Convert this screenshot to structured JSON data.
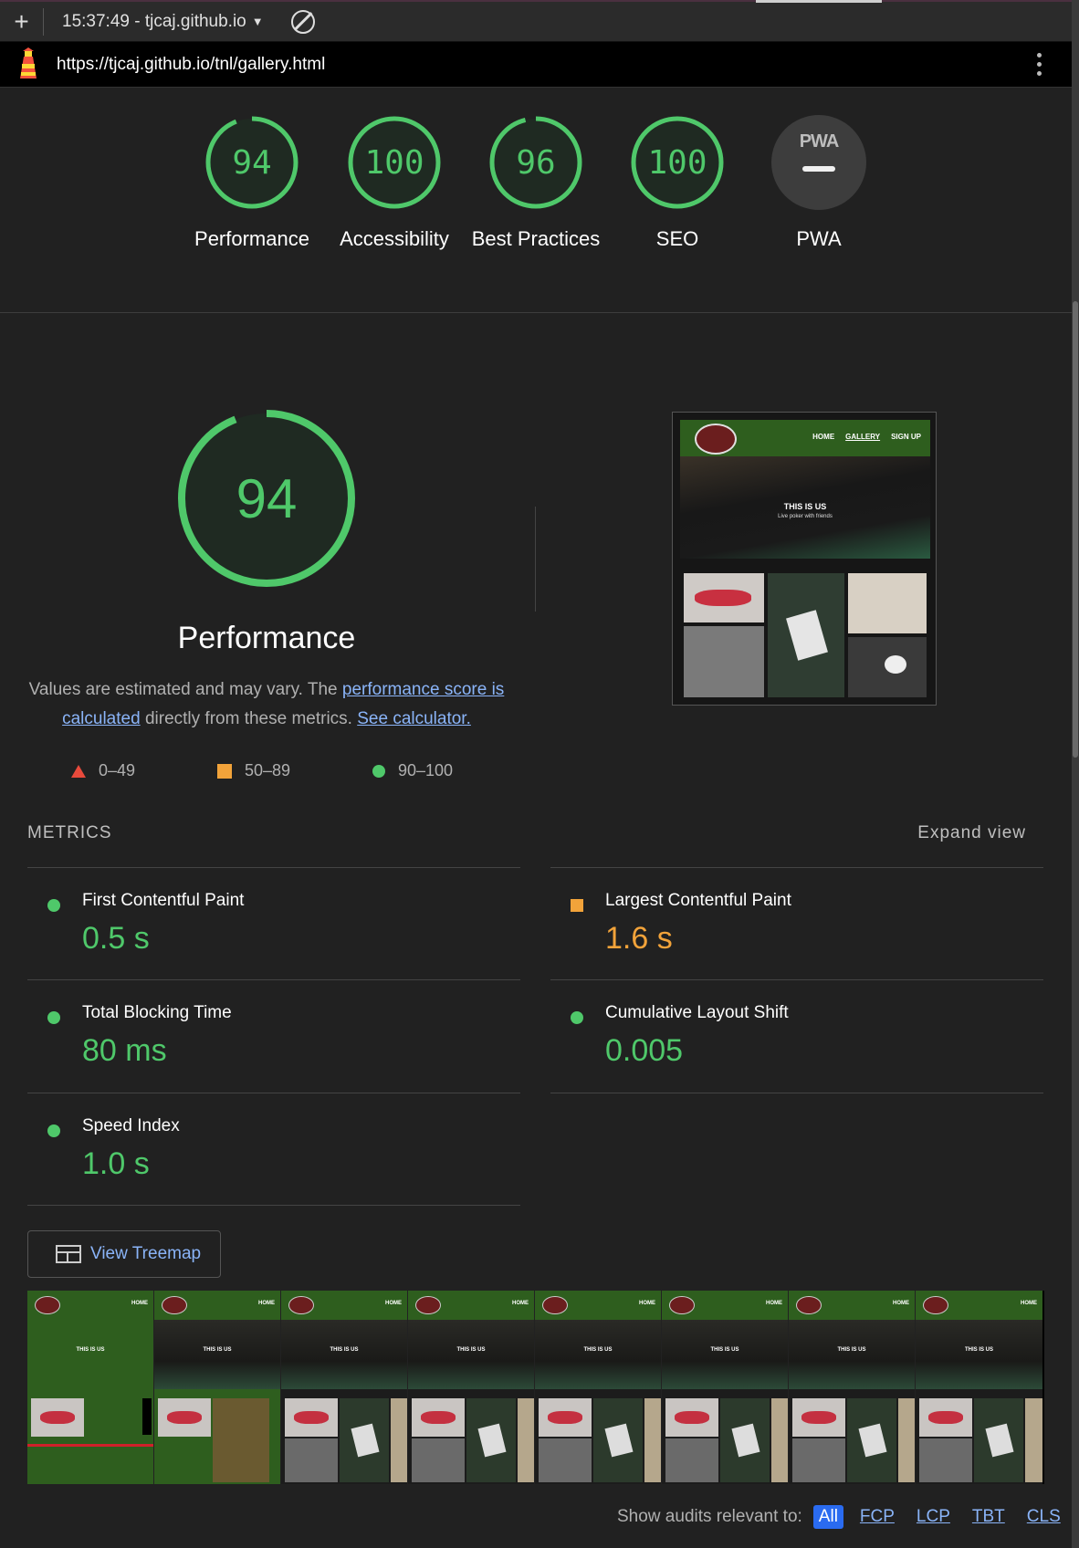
{
  "toolbar": {
    "new_label": "+",
    "report_select": "15:37:49 - tjcaj.github.io"
  },
  "urlbar": {
    "url": "https://tjcaj.github.io/tnl/gallery.html"
  },
  "categories": [
    {
      "label": "Performance",
      "score": 94
    },
    {
      "label": "Accessibility",
      "score": 100
    },
    {
      "label": "Best Practices",
      "score": 96
    },
    {
      "label": "SEO",
      "score": 100
    },
    {
      "label": "PWA",
      "score": null,
      "badge": "PWA"
    }
  ],
  "performance": {
    "score": 94,
    "title": "Performance",
    "desc_prefix": "Values are estimated and may vary. The ",
    "desc_link": "performance score is calculated",
    "desc_middle": " directly from these metrics. ",
    "desc_calc": "See calculator.",
    "final_screenshot": {
      "nav": [
        "HOME",
        "GALLERY",
        "SIGN UP"
      ],
      "hero_title": "THIS IS US",
      "hero_sub": "Live poker with friends"
    }
  },
  "legend": {
    "fail": "0–49",
    "average": "50–89",
    "pass": "90–100"
  },
  "metrics": {
    "title": "METRICS",
    "expand": "Expand view",
    "items": [
      {
        "label": "First Contentful Paint",
        "value": "0.5 s",
        "status": "pass"
      },
      {
        "label": "Largest Contentful Paint",
        "value": "1.6 s",
        "status": "average"
      },
      {
        "label": "Total Blocking Time",
        "value": "80 ms",
        "status": "pass"
      },
      {
        "label": "Cumulative Layout Shift",
        "value": "0.005",
        "status": "pass"
      },
      {
        "label": "Speed Index",
        "value": "1.0 s",
        "status": "pass"
      }
    ]
  },
  "treemap": {
    "label": "View Treemap"
  },
  "filmstrip": {
    "nav_label": "HOME",
    "hero_title": "THIS IS US"
  },
  "audit_filter": {
    "label": "Show audits relevant to:",
    "chips": [
      "All",
      "FCP",
      "LCP",
      "TBT",
      "CLS"
    ]
  },
  "colors": {
    "pass": "#4fc86a",
    "average": "#f2a33a",
    "fail": "#e84a3c",
    "link": "#8ab4f8",
    "background": "#212121"
  }
}
